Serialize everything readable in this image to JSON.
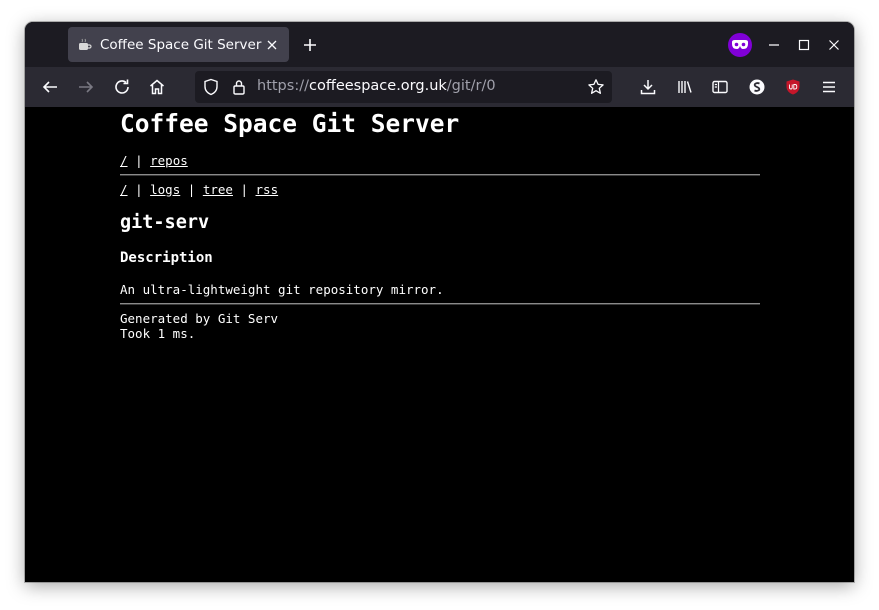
{
  "browser": {
    "tab": {
      "title": "Coffee Space Git Server",
      "favicon": "coffee-cup-icon"
    },
    "url": {
      "scheme": "https://",
      "host": "coffeespace.org.uk",
      "path": "/git/r/0"
    },
    "colors": {
      "titlebar": "#1c1b22",
      "toolbar": "#2b2a33",
      "tab_active": "#42414d",
      "private": "#8000d7",
      "ublock": "#c5162a"
    }
  },
  "page": {
    "site_title": "Coffee Space Git Server",
    "nav_main": {
      "root": "/",
      "sep": "|",
      "repos": "repos"
    },
    "nav_repo": {
      "root": "/",
      "sep1": "|",
      "logs": "logs",
      "sep2": "|",
      "tree": "tree",
      "sep3": "|",
      "rss": "rss"
    },
    "repo_name": "git-serv",
    "description_heading": "Description",
    "description": "An ultra-lightweight git repository mirror.",
    "footer": {
      "generated": "Generated by Git Serv",
      "timing": "Took 1 ms."
    }
  }
}
